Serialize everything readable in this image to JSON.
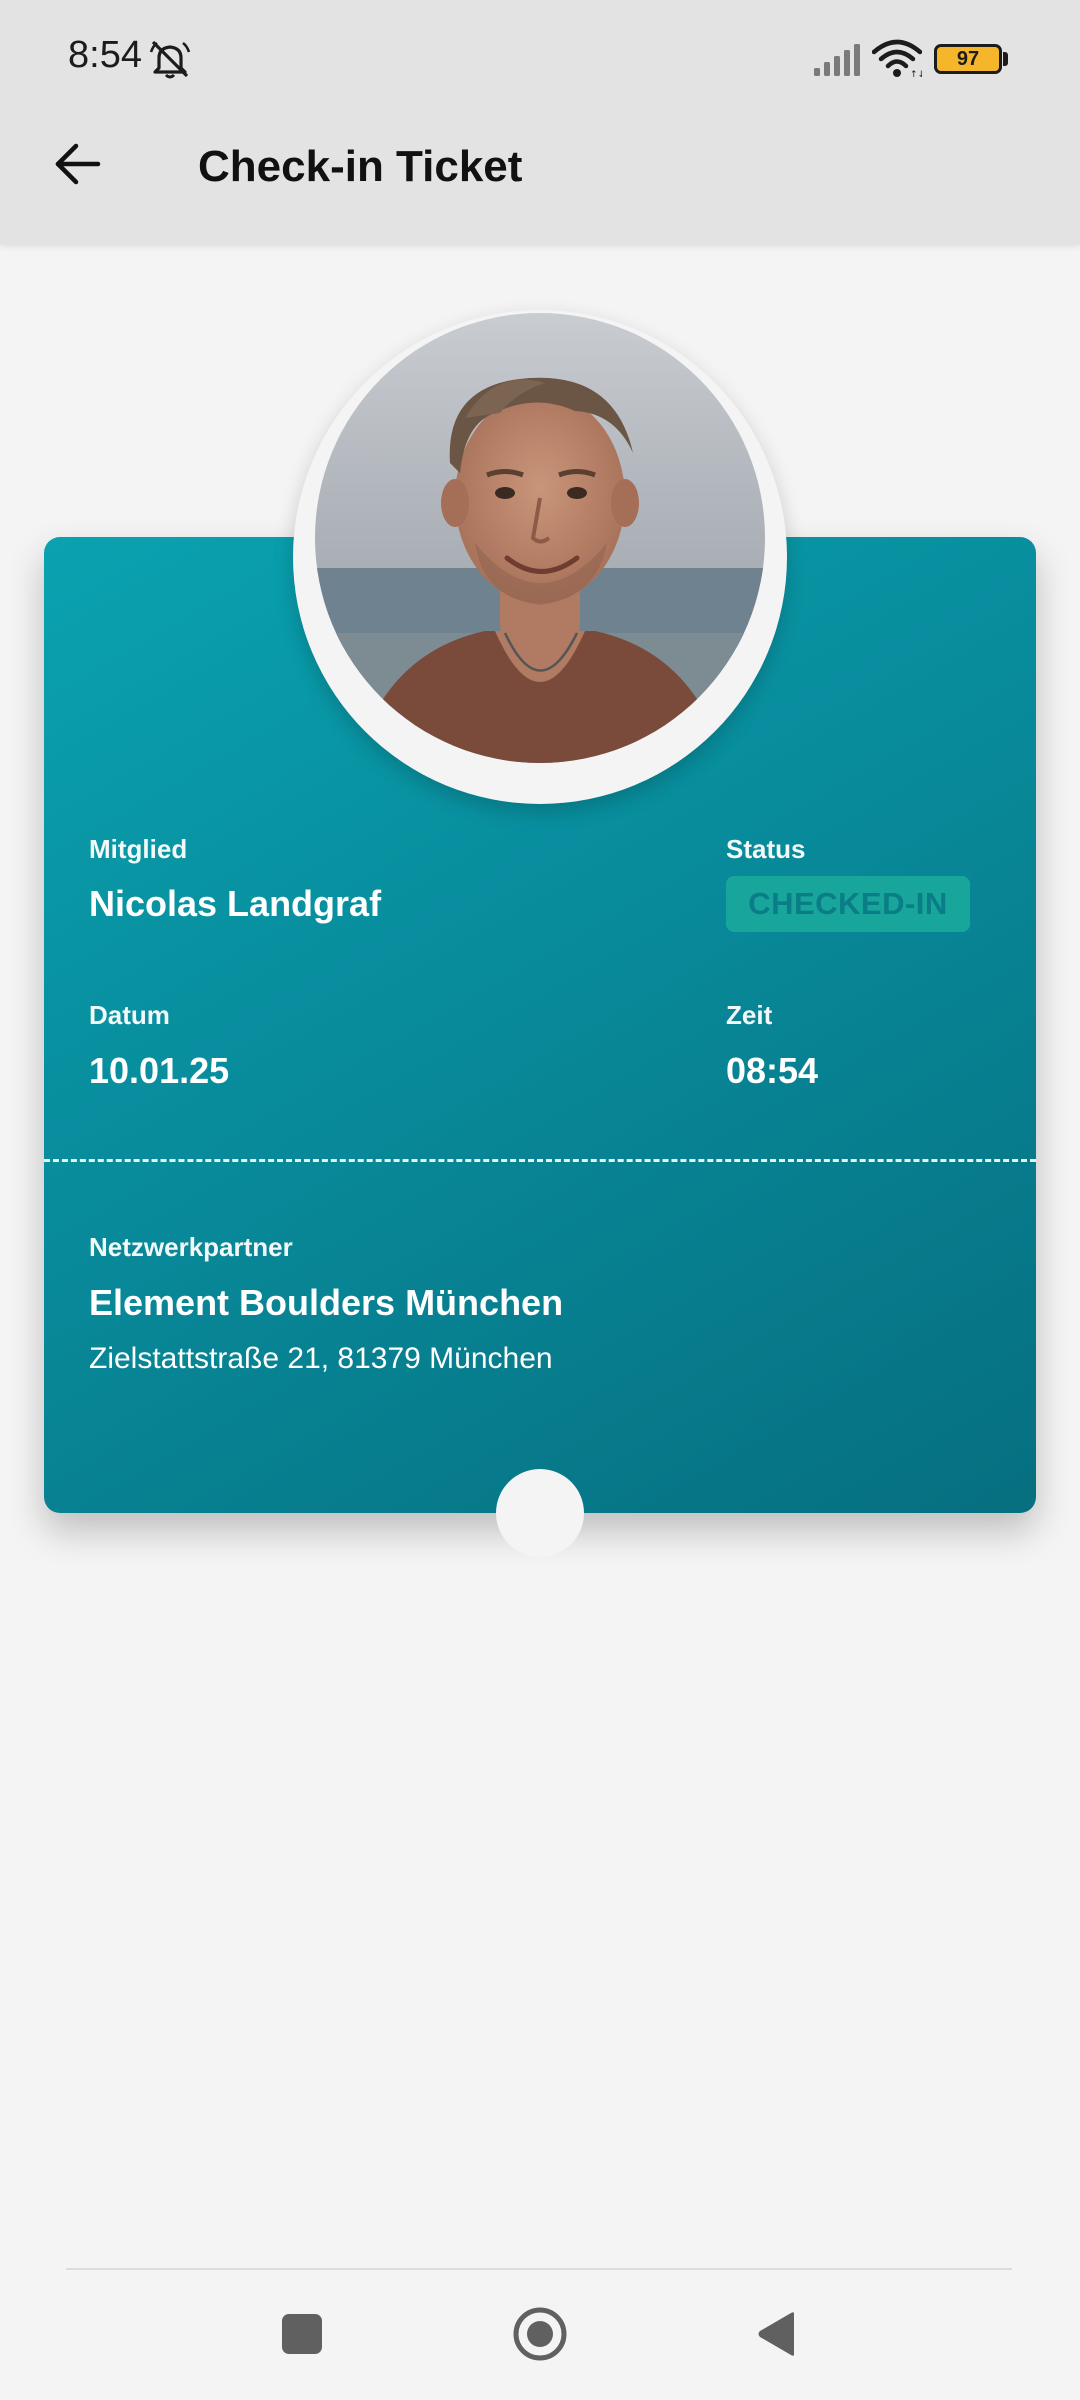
{
  "status_bar": {
    "time": "8:54",
    "battery": "97"
  },
  "app_bar": {
    "title": "Check-in Ticket",
    "back_icon": "arrow-left-icon"
  },
  "ticket": {
    "member_label": "Mitglied",
    "member_name": "Nicolas Landgraf",
    "status_label": "Status",
    "status_value": "CHECKED-IN",
    "date_label": "Datum",
    "date_value": "10.01.25",
    "time_label": "Zeit",
    "time_value": "08:54",
    "partner_label": "Netzwerkpartner",
    "partner_name": "Element Boulders München",
    "partner_address": "Zielstattstraße 21, 81379 München",
    "colors": {
      "gradient_start": "#0aa2b0",
      "gradient_end": "#066f80",
      "badge_bg": "#18a59c",
      "badge_text": "#0a7d86"
    }
  },
  "nav_bar": {
    "icons": [
      "recents-icon",
      "home-icon",
      "back-icon"
    ]
  }
}
